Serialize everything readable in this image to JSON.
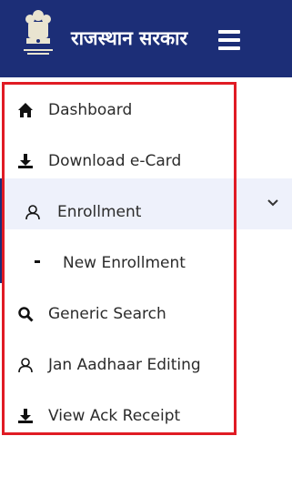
{
  "header": {
    "title": "राजस्थान सरकार",
    "emblem_icon": "state-emblem-icon",
    "menu_icon": "hamburger-menu-icon",
    "bg_color": "#1c2e77"
  },
  "sidebar": {
    "border_color": "#e01b24",
    "active_bg_color": "#eef1fb",
    "items": [
      {
        "label": "Dashboard",
        "icon": "home-icon"
      },
      {
        "label": "Download e-Card",
        "icon": "download-icon"
      },
      {
        "label": "Enrollment",
        "icon": "user-icon",
        "expanded": true,
        "chevron_icon": "chevron-down-icon"
      },
      {
        "label": "New Enrollment",
        "icon": "dash-icon"
      },
      {
        "label": "Generic Search",
        "icon": "search-icon"
      },
      {
        "label": "Jan Aadhaar Editing",
        "icon": "user-icon"
      },
      {
        "label": "View Ack Receipt",
        "icon": "download-icon"
      }
    ]
  }
}
